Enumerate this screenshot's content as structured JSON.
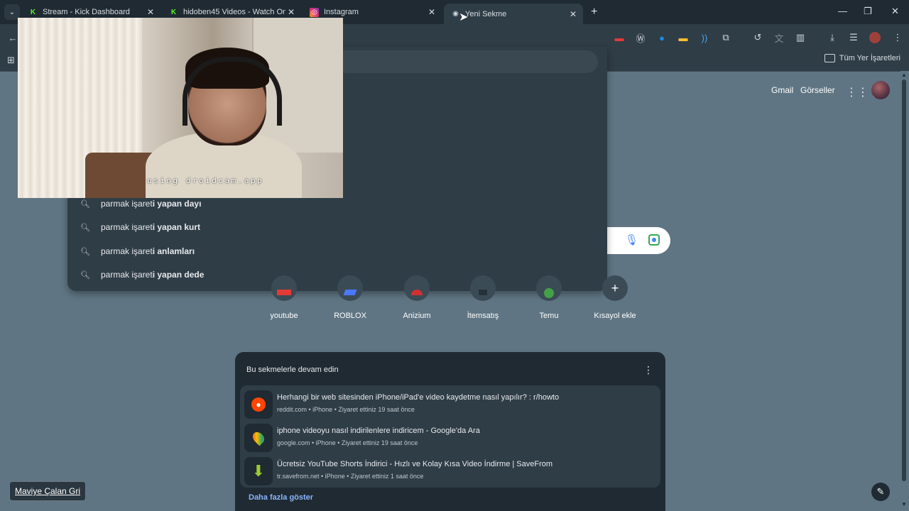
{
  "tabs": [
    {
      "title": "Stream - Kick Dashboard",
      "favicon": "kick-icon",
      "active": false
    },
    {
      "title": "hidoben45 Videos - Watch On-",
      "favicon": "kick-icon",
      "active": false
    },
    {
      "title": "Instagram",
      "favicon": "instagram-icon",
      "active": false
    },
    {
      "title": "Yeni Sekme",
      "favicon": "chrome-icon",
      "active": true
    }
  ],
  "bookmarks": {
    "all_label": "Tüm Yer İşaretleri"
  },
  "header": {
    "gmail": "Gmail",
    "images": "Görseller"
  },
  "suggestions": [
    {
      "prefix": "parmak işaret",
      "bold": "i yapan dayı"
    },
    {
      "prefix": "parmak işaret",
      "bold": "i yapan kurt"
    },
    {
      "prefix": "parmak işaret",
      "bold": "i anlamları"
    },
    {
      "prefix": "parmak işaret",
      "bold": "i yapan dede"
    }
  ],
  "shortcuts": [
    {
      "label": "youtube"
    },
    {
      "label": "ROBLOX"
    },
    {
      "label": "Anizium"
    },
    {
      "label": "İtemsatış"
    },
    {
      "label": "Temu"
    },
    {
      "label": "Kısayol ekle"
    }
  ],
  "continue_card": {
    "title": "Bu sekmelerle devam edin",
    "items": [
      {
        "title": "Herhangi bir web sitesinden iPhone/iPad'e video kaydetme nasıl yapılır? : r/howto",
        "meta": "reddit.com • iPhone • Ziyaret ettiniz 19 saat önce",
        "icon": "reddit-icon"
      },
      {
        "title": "iphone videoyu nasıl indirilenlere indiricem - Google'da Ara",
        "meta": "google.com • iPhone • Ziyaret ettiniz 19 saat önce",
        "icon": "google-maps-icon"
      },
      {
        "title": "Ücretsiz YouTube Shorts İndirici - Hızlı ve Kolay Kısa Video İndirme | SaveFrom",
        "meta": "tr.savefrom.net • iPhone • Ziyaret ettiniz 1 saat önce",
        "icon": "download-arrow-icon"
      }
    ],
    "more_label": "Daha fazla göster"
  },
  "webcam": {
    "caption": "using droidcam.app"
  },
  "theme_tooltip": "Maviye Çalan Gri",
  "colors": {
    "background": "#5f7583",
    "chrome_dark": "#1f2a33",
    "chrome_mid": "#2f3d47",
    "link": "#8ab4f8"
  }
}
